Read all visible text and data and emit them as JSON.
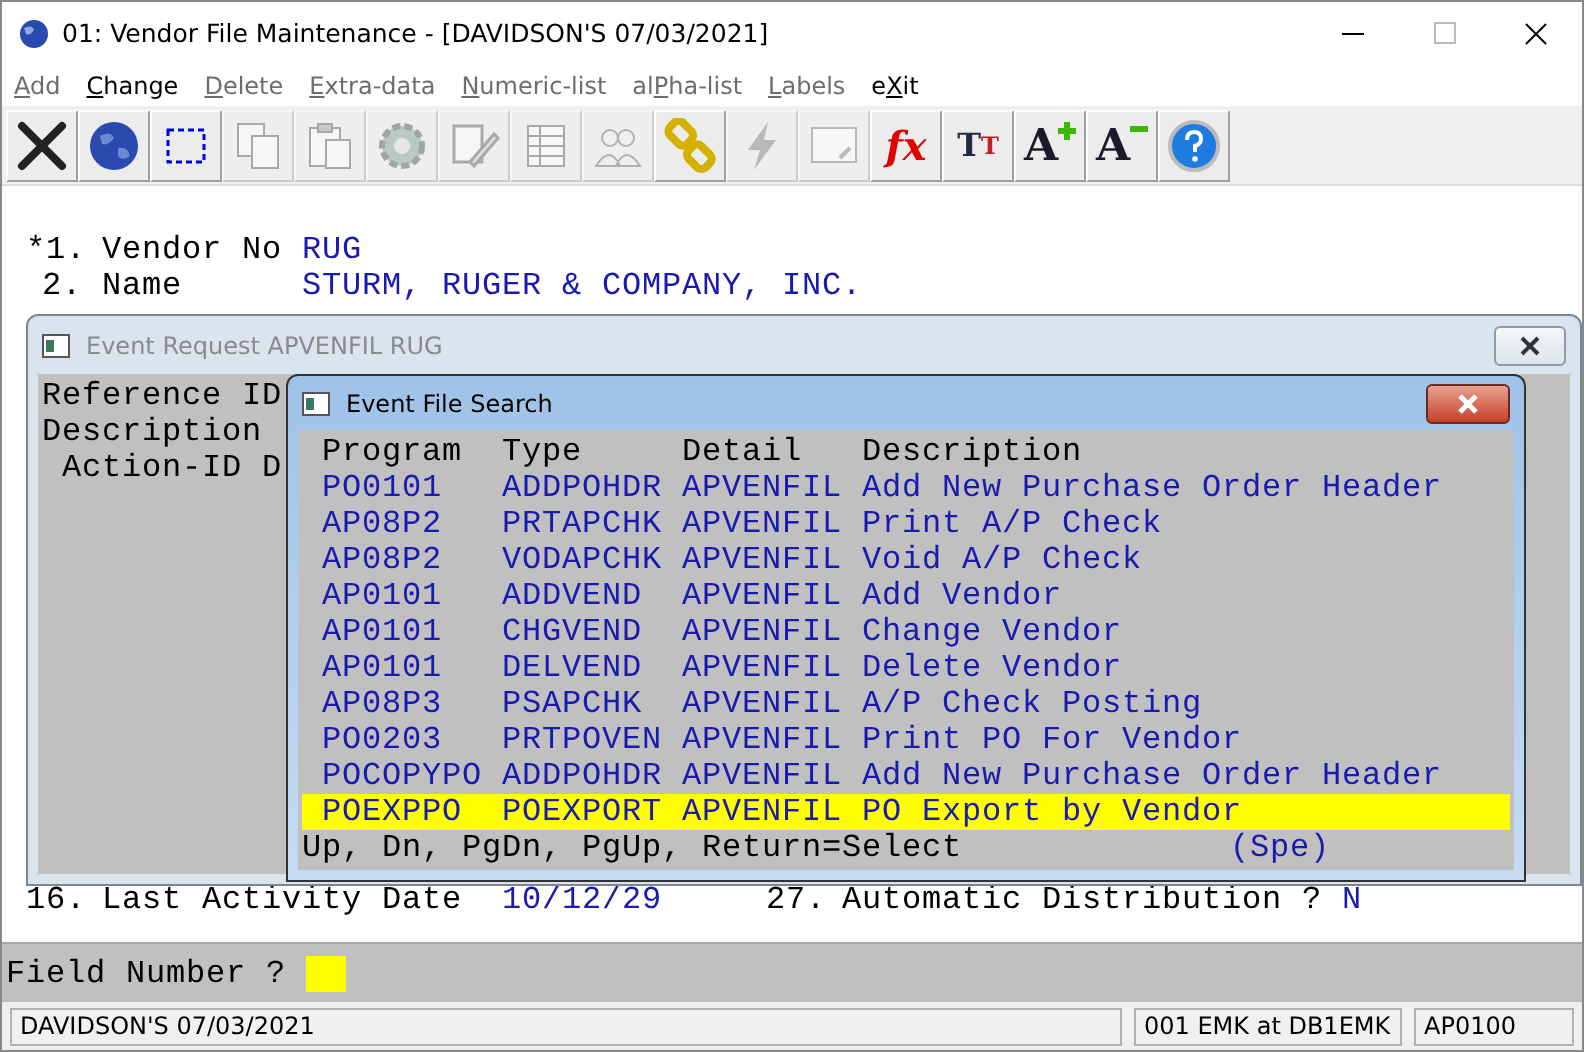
{
  "window": {
    "title": "01: Vendor File Maintenance - [DAVIDSON'S 07/03/2021]"
  },
  "menu": [
    {
      "key": "A",
      "after": "dd",
      "disabled": true
    },
    {
      "key": "C",
      "after": "hange",
      "disabled": false
    },
    {
      "key": "D",
      "after": "elete",
      "disabled": true
    },
    {
      "key": "E",
      "after": "xtra-data",
      "disabled": true
    },
    {
      "key": "N",
      "after": "umeric-list",
      "disabled": true
    },
    {
      "before": "al",
      "key": "P",
      "after": "ha-list",
      "disabled": true
    },
    {
      "key": "L",
      "after": "abels",
      "disabled": true
    },
    {
      "before": "e",
      "key": "X",
      "after": "it",
      "disabled": false
    }
  ],
  "toolbar": [
    {
      "kind": "close",
      "disabled": false
    },
    {
      "kind": "globe",
      "disabled": false
    },
    {
      "kind": "select",
      "disabled": false
    },
    {
      "kind": "copy",
      "disabled": true
    },
    {
      "kind": "paste",
      "disabled": true
    },
    {
      "kind": "gear",
      "disabled": true
    },
    {
      "kind": "edit",
      "disabled": true
    },
    {
      "kind": "table",
      "disabled": true
    },
    {
      "kind": "people",
      "disabled": true
    },
    {
      "kind": "link",
      "disabled": false
    },
    {
      "kind": "bolt",
      "disabled": true
    },
    {
      "kind": "window",
      "disabled": true
    },
    {
      "kind": "formula",
      "label": "fx",
      "disabled": false
    },
    {
      "kind": "font",
      "label": "T",
      "label2": "T",
      "disabled": false
    },
    {
      "kind": "grow",
      "label": "A",
      "disabled": false
    },
    {
      "kind": "shrink",
      "label": "A",
      "disabled": false
    },
    {
      "kind": "help",
      "disabled": false
    }
  ],
  "fields": [
    {
      "number": "*1.",
      "label": "Vendor No",
      "value": "RUG"
    },
    {
      "number": "2.",
      "label": "Name",
      "value": "STURM, RUGER & COMPANY, INC."
    }
  ],
  "bottom_fields": [
    {
      "number": "16.",
      "label": "Last Activity Date",
      "value": "10/12/29"
    },
    {
      "number": "27.",
      "label": "Automatic Distribution ?",
      "value": "N"
    }
  ],
  "event_request": {
    "title": "Event Request APVENFIL RUG",
    "lines": [
      "Reference ID",
      "Description",
      "Action-ID D"
    ]
  },
  "event_search": {
    "title": "Event File Search",
    "columns": [
      "Program",
      "Type",
      "Detail",
      "Description"
    ],
    "rows": [
      {
        "program": "PO0101",
        "type": "ADDPOHDR",
        "detail": "APVENFIL",
        "description": "Add New Purchase Order Header",
        "selected": false
      },
      {
        "program": "AP08P2",
        "type": "PRTAPCHK",
        "detail": "APVENFIL",
        "description": "Print A/P Check",
        "selected": false
      },
      {
        "program": "AP08P2",
        "type": "VODAPCHK",
        "detail": "APVENFIL",
        "description": "Void A/P Check",
        "selected": false
      },
      {
        "program": "AP0101",
        "type": "ADDVEND",
        "detail": "APVENFIL",
        "description": "Add Vendor",
        "selected": false
      },
      {
        "program": "AP0101",
        "type": "CHGVEND",
        "detail": "APVENFIL",
        "description": "Change Vendor",
        "selected": false
      },
      {
        "program": "AP0101",
        "type": "DELVEND",
        "detail": "APVENFIL",
        "description": "Delete Vendor",
        "selected": false
      },
      {
        "program": "AP08P3",
        "type": "PSAPCHK",
        "detail": "APVENFIL",
        "description": "A/P Check Posting",
        "selected": false
      },
      {
        "program": "PO0203",
        "type": "PRTPOVEN",
        "detail": "APVENFIL",
        "description": "Print PO For Vendor",
        "selected": false
      },
      {
        "program": "POCOPYPO",
        "type": "ADDPOHDR",
        "detail": "APVENFIL",
        "description": "Add New Purchase Order Header",
        "selected": false
      },
      {
        "program": "POEXPPO",
        "type": "POEXPORT",
        "detail": "APVENFIL",
        "description": "PO Export by Vendor",
        "selected": true
      }
    ],
    "hint": "Up, Dn, PgDn, PgUp, Return=Select",
    "hint_right": "(Spe)"
  },
  "prompt": {
    "label": "Field Number ?"
  },
  "status_bar": [
    "DAVIDSON'S 07/03/2021",
    "001 EMK at DB1EMK",
    "AP0100"
  ]
}
